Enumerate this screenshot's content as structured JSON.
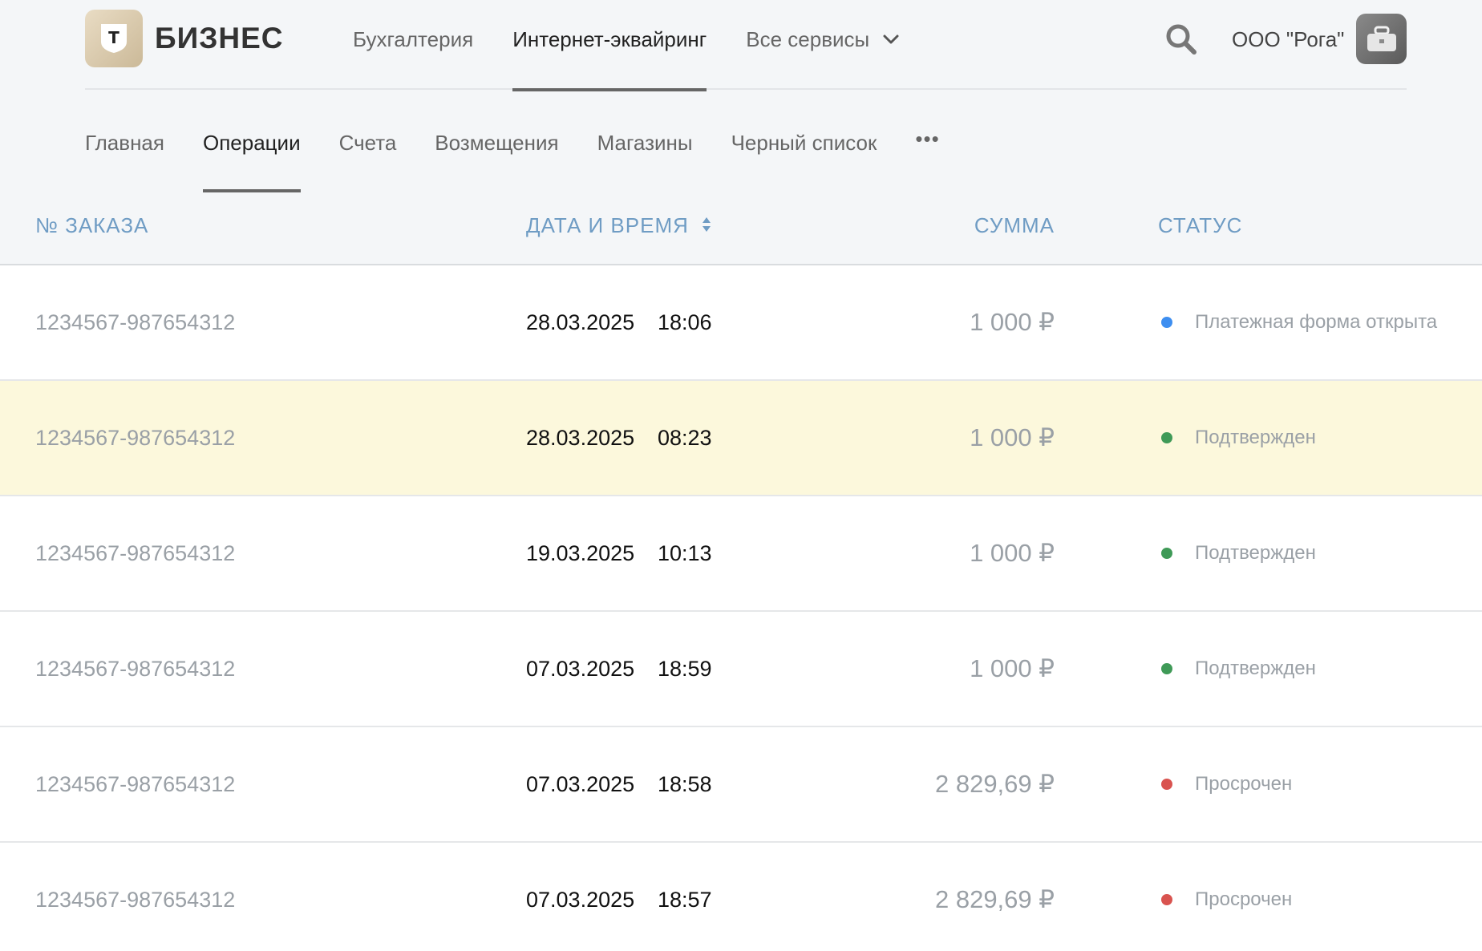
{
  "header": {
    "brand": "БИЗНЕС",
    "logo_letter": "Т",
    "nav": [
      {
        "label": "Бухгалтерия",
        "active": false
      },
      {
        "label": "Интернет-эквайринг",
        "active": true
      },
      {
        "label": "Все сервисы",
        "active": false,
        "dropdown": true
      }
    ],
    "org_name": "ООО \"Рога\""
  },
  "subnav": {
    "items": [
      {
        "label": "Главная",
        "active": false
      },
      {
        "label": "Операции",
        "active": true
      },
      {
        "label": "Счета",
        "active": false
      },
      {
        "label": "Возмещения",
        "active": false
      },
      {
        "label": "Магазины",
        "active": false
      },
      {
        "label": "Черный список",
        "active": false
      }
    ],
    "more": "•••"
  },
  "table": {
    "columns": {
      "order": "№ ЗАКАЗА",
      "date": "ДАТА И ВРЕМЯ",
      "sum": "СУММА",
      "status": "СТАТУС"
    },
    "rows": [
      {
        "order": "1234567-987654312",
        "date": "28.03.2025",
        "time": "18:06",
        "sum": "1 000 ₽",
        "status": "Платежная форма открыта",
        "status_color": "#3d8ef0",
        "highlight": false
      },
      {
        "order": "1234567-987654312",
        "date": "28.03.2025",
        "time": "08:23",
        "sum": "1 000 ₽",
        "status": "Подтвержден",
        "status_color": "#3f9a57",
        "highlight": true
      },
      {
        "order": "1234567-987654312",
        "date": "19.03.2025",
        "time": "10:13",
        "sum": "1 000 ₽",
        "status": "Подтвержден",
        "status_color": "#3f9a57",
        "highlight": false
      },
      {
        "order": "1234567-987654312",
        "date": "07.03.2025",
        "time": "18:59",
        "sum": "1 000 ₽",
        "status": "Подтвержден",
        "status_color": "#3f9a57",
        "highlight": false
      },
      {
        "order": "1234567-987654312",
        "date": "07.03.2025",
        "time": "18:58",
        "sum": "2 829,69 ₽",
        "status": "Просрочен",
        "status_color": "#d9534f",
        "highlight": false
      },
      {
        "order": "1234567-987654312",
        "date": "07.03.2025",
        "time": "18:57",
        "sum": "2 829,69 ₽",
        "status": "Просрочен",
        "status_color": "#d9534f",
        "highlight": false
      }
    ]
  }
}
